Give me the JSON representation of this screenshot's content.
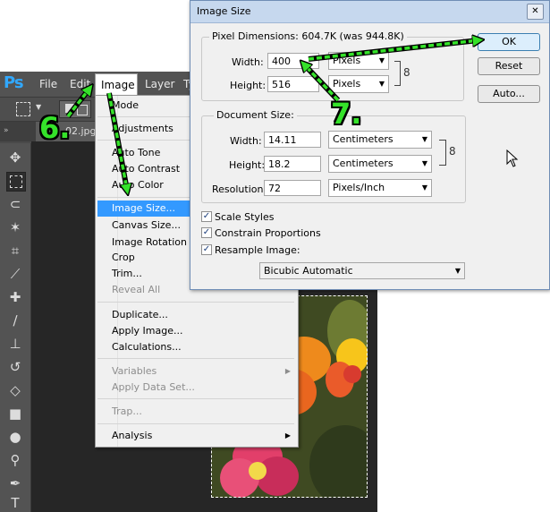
{
  "photoshop": {
    "logo": "Ps",
    "menus": [
      "File",
      "Edit",
      "Image",
      "Layer",
      "Ty"
    ],
    "doc_tab": "02.jpg"
  },
  "image_menu": {
    "items": [
      {
        "label": "Mode",
        "state": "normal",
        "submenu": true
      },
      {
        "label": "Adjustments",
        "state": "normal",
        "submenu": true
      },
      {
        "label": "Auto Tone",
        "state": "normal"
      },
      {
        "label": "Auto Contrast",
        "state": "normal"
      },
      {
        "label": "Auto Color",
        "state": "normal"
      },
      {
        "label": "Image Size...",
        "state": "highlighted"
      },
      {
        "label": "Canvas Size...",
        "state": "normal"
      },
      {
        "label": "Image Rotation",
        "state": "normal",
        "submenu": true
      },
      {
        "label": "Crop",
        "state": "normal"
      },
      {
        "label": "Trim...",
        "state": "normal"
      },
      {
        "label": "Reveal All",
        "state": "disabled"
      },
      {
        "label": "Duplicate...",
        "state": "normal"
      },
      {
        "label": "Apply Image...",
        "state": "normal"
      },
      {
        "label": "Calculations...",
        "state": "normal"
      },
      {
        "label": "Variables",
        "state": "disabled",
        "submenu": true
      },
      {
        "label": "Apply Data Set...",
        "state": "disabled"
      },
      {
        "label": "Trap...",
        "state": "disabled"
      },
      {
        "label": "Analysis",
        "state": "normal",
        "submenu": true
      }
    ]
  },
  "dialog": {
    "title": "Image Size",
    "close_glyph": "✕",
    "pixel_dimensions": {
      "label": "Pixel Dimensions:",
      "value": "604.7K (was 944.8K)",
      "width_label": "Width:",
      "width_value": "400",
      "width_unit": "Pixels",
      "height_label": "Height:",
      "height_value": "516",
      "height_unit": "Pixels"
    },
    "document_size": {
      "label": "Document Size:",
      "width_label": "Width:",
      "width_value": "14.11",
      "width_unit": "Centimeters",
      "height_label": "Height:",
      "height_value": "18.2",
      "height_unit": "Centimeters",
      "resolution_label": "Resolution:",
      "resolution_value": "72",
      "resolution_unit": "Pixels/Inch"
    },
    "checkboxes": [
      {
        "label": "Scale Styles",
        "checked": true
      },
      {
        "label": "Constrain Proportions",
        "checked": true
      },
      {
        "label": "Resample Image:",
        "checked": true
      }
    ],
    "resample_method": "Bicubic Automatic",
    "buttons": {
      "ok": "OK",
      "reset": "Reset",
      "auto": "Auto..."
    }
  },
  "annotations": {
    "step6": "6.",
    "step7": "7.",
    "color": "#35e22a"
  },
  "colors": {
    "menu_highlight": "#3399ff",
    "ps_blue": "#31a8ff",
    "dialog_titlebar": "#c6d8ee"
  }
}
